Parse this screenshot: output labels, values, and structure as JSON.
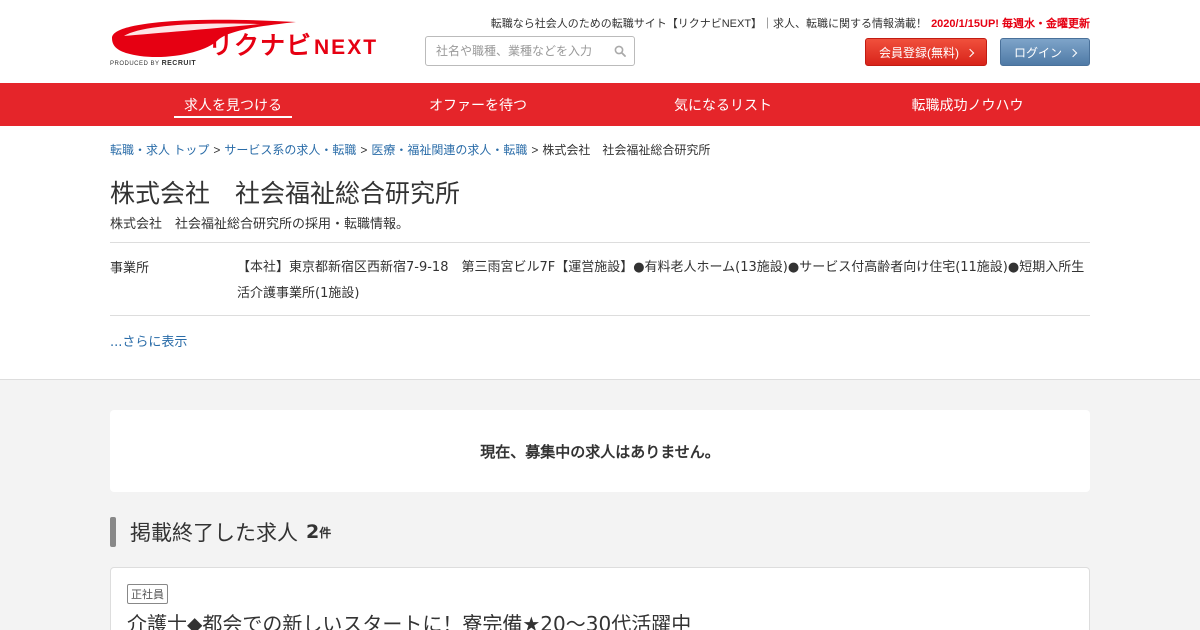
{
  "header": {
    "logo_text": "リクナビ",
    "logo_next": "NEXT",
    "logo_produced": "PRODUCED BY",
    "logo_recruit": "RECRUIT",
    "tagline": "転職なら社会人のための転職サイト【リクナビNEXT】｜求人、転職に関する情報満載！",
    "update_note": "2020/1/15UP! 毎週水・金曜更新",
    "search_placeholder": "社名や職種、業種などを入力",
    "register_label": "会員登録(無料)",
    "login_label": "ログイン"
  },
  "nav": {
    "items": [
      {
        "label": "求人を見つける"
      },
      {
        "label": "オファーを待つ"
      },
      {
        "label": "気になるリスト"
      },
      {
        "label": "転職成功ノウハウ"
      }
    ]
  },
  "breadcrumb": {
    "items": [
      {
        "label": "転職・求人 トップ"
      },
      {
        "label": "サービス系の求人・転職"
      },
      {
        "label": "医療・福祉関連の求人・転職"
      }
    ],
    "separator": ">",
    "current": "株式会社　社会福祉総合研究所"
  },
  "company": {
    "name": "株式会社　社会福祉総合研究所",
    "subtitle": "株式会社　社会福祉総合研究所の採用・転職情報。",
    "office_label": "事業所",
    "office_value": "【本社】東京都新宿区西新宿7-9-18　第三雨宮ビル7F【運営施設】●有料老人ホーム(13施設)●サービス付高齢者向け住宅(11施設)●短期入所生活介護事業所(1施設)",
    "show_more": "...さらに表示"
  },
  "notice": "現在、募集中の求人はありません。",
  "ended": {
    "title": "掲載終了した求人",
    "count": "2",
    "unit": "件"
  },
  "job": {
    "badge": "正社員",
    "title": "介護士◆都会での新しいスタートに！寮完備★20～30代活躍中"
  },
  "colors": {
    "brand_red": "#e5252a",
    "link_blue": "#2a6ca8",
    "login_blue": "#5b86b2"
  }
}
